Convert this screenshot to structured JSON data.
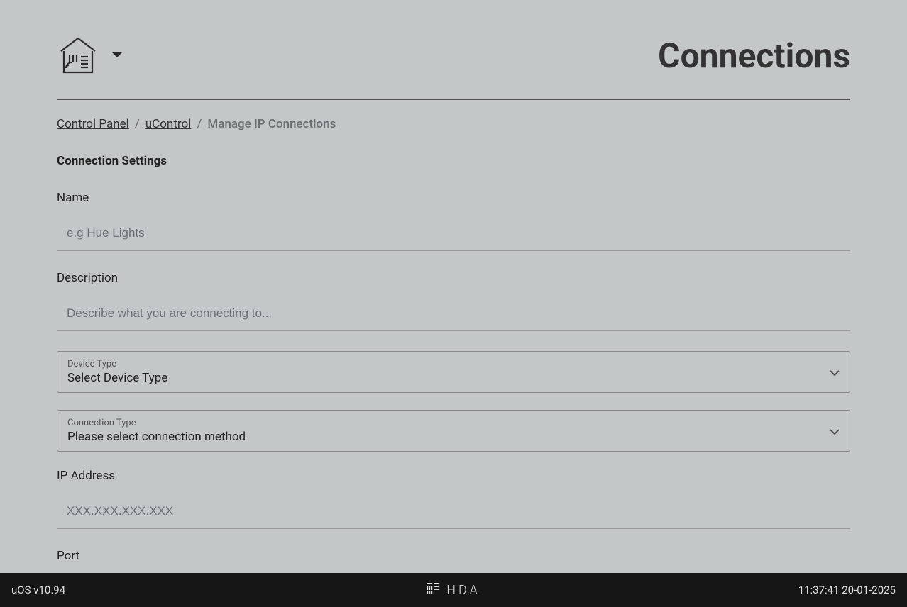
{
  "header": {
    "page_title": "Connections"
  },
  "breadcrumb": {
    "items": [
      {
        "label": "Control Panel"
      },
      {
        "label": "uControl"
      }
    ],
    "current": "Manage IP Connections"
  },
  "form": {
    "section_title": "Connection Settings",
    "name": {
      "label": "Name",
      "placeholder": "e.g Hue Lights",
      "value": ""
    },
    "description": {
      "label": "Description",
      "placeholder": "Describe what you are connecting to...",
      "value": ""
    },
    "device_type": {
      "small_label": "Device Type",
      "value": "Select Device Type"
    },
    "connection_type": {
      "small_label": "Connection Type",
      "value": "Please select connection method"
    },
    "ip_address": {
      "label": "IP Address",
      "placeholder": "XXX.XXX.XXX.XXX",
      "value": ""
    },
    "port": {
      "label": "Port"
    }
  },
  "footer": {
    "version": "uOS v10.94",
    "brand": "HDA",
    "timestamp": "11:37:41 20-01-2025"
  }
}
